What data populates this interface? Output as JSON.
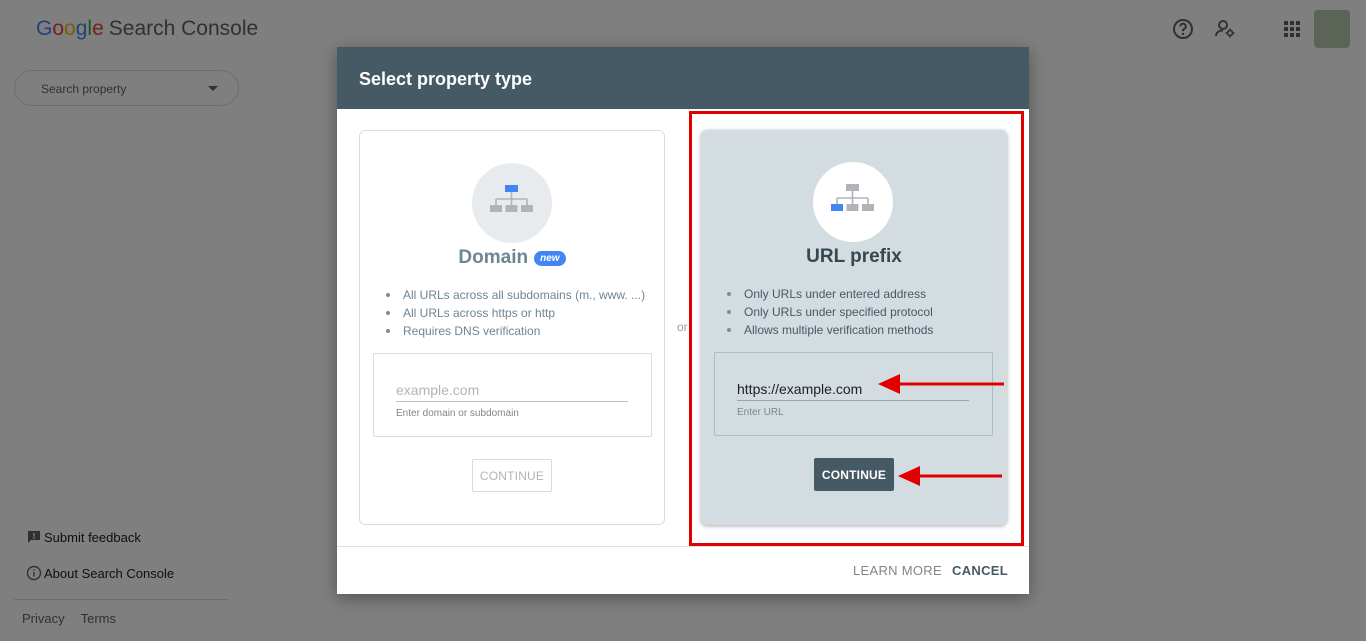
{
  "app": {
    "logo_letters": [
      "G",
      "o",
      "o",
      "g",
      "l",
      "e"
    ],
    "product_name": "Search Console",
    "search_property_placeholder": "Search property",
    "header_icons": [
      "help-icon",
      "admin-icon",
      "apps-icon"
    ],
    "sidebar": {
      "submit_feedback": "Submit feedback",
      "about": "About Search Console"
    },
    "footer": {
      "privacy": "Privacy",
      "terms": "Terms"
    }
  },
  "dialog": {
    "title": "Select property type",
    "separator": "or",
    "domain": {
      "title": "Domain",
      "badge": "new",
      "bullets": [
        "All URLs across all subdomains (m., www. ...)",
        "All URLs across https or http",
        "Requires DNS verification"
      ],
      "input_placeholder": "example.com",
      "input_value": "",
      "input_help": "Enter domain or subdomain",
      "continue_label": "CONTINUE"
    },
    "url_prefix": {
      "title": "URL prefix",
      "bullets": [
        "Only URLs under entered address",
        "Only URLs under specified protocol",
        "Allows multiple verification methods"
      ],
      "input_value": "https://example.com",
      "input_help": "Enter URL",
      "continue_label": "CONTINUE"
    },
    "footer": {
      "learn_more": "LEARN MORE",
      "cancel": "CANCEL"
    }
  },
  "colors": {
    "dialog_header": "#455a64",
    "selected_card": "#d3dce0",
    "annotation_red": "#e00000",
    "google_blue": "#4285f4"
  }
}
